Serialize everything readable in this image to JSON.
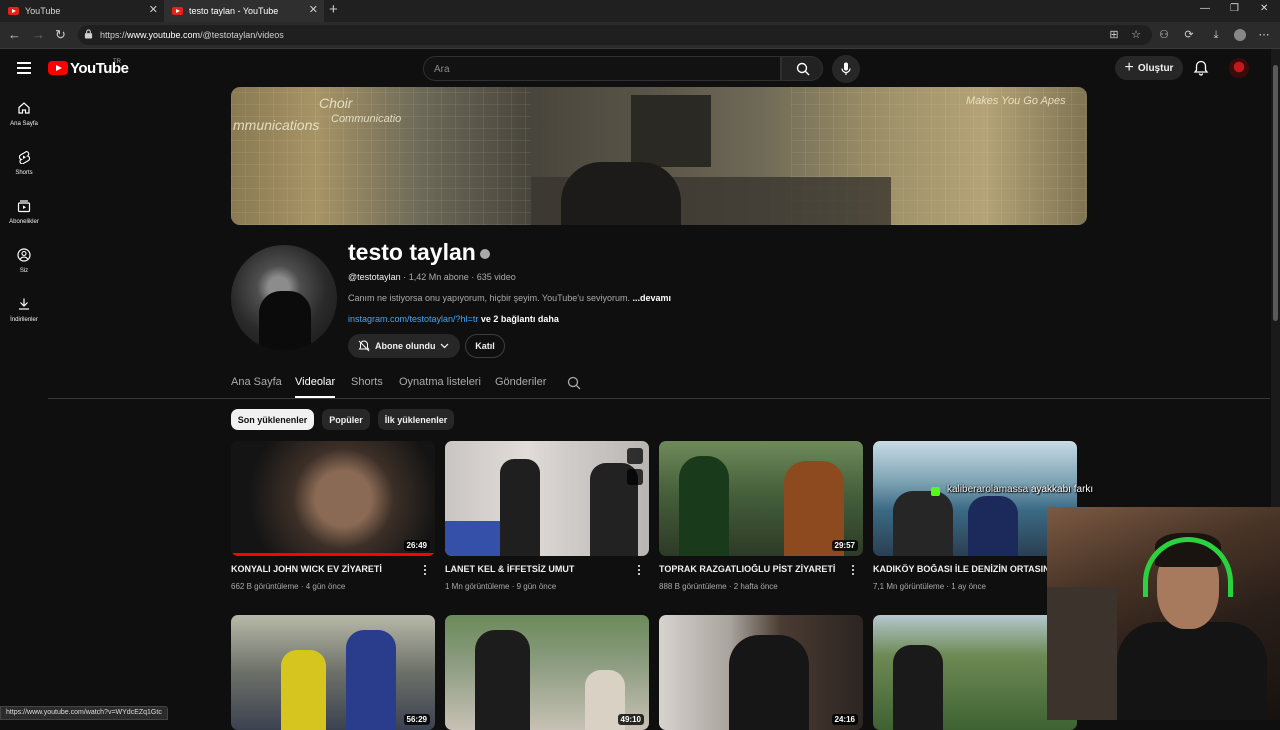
{
  "browser": {
    "tabs": [
      {
        "label": "YouTube",
        "active": false
      },
      {
        "label": "testo taylan - YouTube",
        "active": true
      }
    ],
    "url_prefix": "https://",
    "url_host": "www.youtube.com",
    "url_path": "/@testotaylan/videos"
  },
  "header": {
    "logo_text": "YouTube",
    "country": "TR",
    "search_placeholder": "Ara",
    "create_label": "Oluştur"
  },
  "sidebar": {
    "items": [
      {
        "label": "Ana Sayfa",
        "icon": "home-icon"
      },
      {
        "label": "Shorts",
        "icon": "shorts-icon"
      },
      {
        "label": "Abonelikler",
        "icon": "subscriptions-icon"
      },
      {
        "label": "Siz",
        "icon": "you-icon"
      },
      {
        "label": "İndirilenler",
        "icon": "download-icon"
      }
    ]
  },
  "banner": {
    "poster_1": "mmunications",
    "poster_2": "Choir",
    "poster_3": "Communicatio",
    "poster_4": "Makes You Go Apes"
  },
  "channel": {
    "name": "testo taylan",
    "handle": "@testotaylan",
    "subscribers": "1,42 Mn abone",
    "video_count": "635 video",
    "description": "Canım ne istiyorsa onu yapıyorum, hiçbir şeyim. YouTube'u seviyorum.",
    "more_label": "...devamı",
    "link": "instagram.com/testotaylan/?hl=tr",
    "more_links": "ve 2 bağlantı daha",
    "subscribed_label": "Abone olundu",
    "join_label": "Katıl"
  },
  "tabs": [
    {
      "label": "Ana Sayfa",
      "active": false
    },
    {
      "label": "Videolar",
      "active": true
    },
    {
      "label": "Shorts",
      "active": false
    },
    {
      "label": "Oynatma listeleri",
      "active": false
    },
    {
      "label": "Gönderiler",
      "active": false
    }
  ],
  "chips": [
    {
      "label": "Son yüklenenler",
      "selected": true
    },
    {
      "label": "Popüler",
      "selected": false
    },
    {
      "label": "İlk yüklenenler",
      "selected": false
    }
  ],
  "videos_row1": [
    {
      "title": "KONYALI JOHN WICK EV ZİYARETİ",
      "views": "662 B görüntüleme",
      "age": "4 gün önce",
      "duration": "26:49",
      "watched": 1.0
    },
    {
      "title": "LANET KEL & İFFETSİZ UMUT",
      "views": "1 Mn görüntüleme",
      "age": "9 gün önce",
      "duration": ""
    },
    {
      "title": "TOPRAK RAZGATLIOĞLU PİST ZİYARETİ",
      "views": "888 B görüntüleme",
      "age": "2 hafta önce",
      "duration": "29:57"
    },
    {
      "title": "KADIKÖY BOĞASI İLE DENİZİN ORTASINDA",
      "views": "7,1 Mn görüntüleme",
      "age": "1 ay önce",
      "duration": ""
    }
  ],
  "videos_row2": [
    {
      "duration": "56:29"
    },
    {
      "duration": "49:10"
    },
    {
      "duration": "24:16"
    },
    {
      "duration": ""
    }
  ],
  "overlay": {
    "user": "kaliberarolamassa",
    "message": "ayakkabı farkı"
  },
  "status_bar": "https://www.youtube.com/watch?v=WYdcEZq1Gtc"
}
